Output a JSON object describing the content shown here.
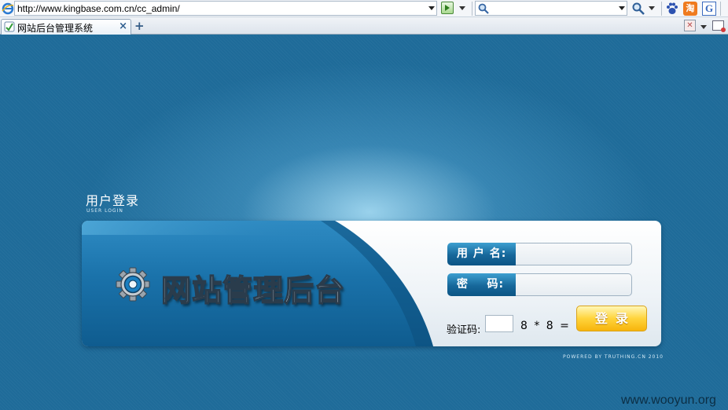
{
  "browser": {
    "url": "http://www.kingbase.com.cn/cc_admin/",
    "search_value": "",
    "toolbar_icons": [
      "ie-icon",
      "go-icon",
      "search-icon",
      "paw-icon",
      "taobao-icon",
      "google-icon"
    ],
    "taobao_glyph": "淘",
    "google_glyph": "G"
  },
  "tabs": [
    {
      "title": "网站后台管理系统",
      "close": "×"
    }
  ],
  "new_tab_label": "+",
  "login": {
    "title": "用户登录",
    "subtitle": "USER LOGIN",
    "brand": "网站管理后台",
    "username_label": "用 户 名:",
    "username_value": "",
    "password_label": "密    码:",
    "password_value": "",
    "captcha_label": "验证码:",
    "captcha_value": "",
    "captcha_question": "8 * 8 = ?",
    "submit_label": "登录"
  },
  "footer": {
    "powered": "POWERED BY TRUTHING.CN 2010",
    "watermark": "www.wooyun.org"
  },
  "colors": {
    "page_bg": "#1e6b99",
    "label_bg": "#16679a",
    "button": "#ffd43c"
  }
}
